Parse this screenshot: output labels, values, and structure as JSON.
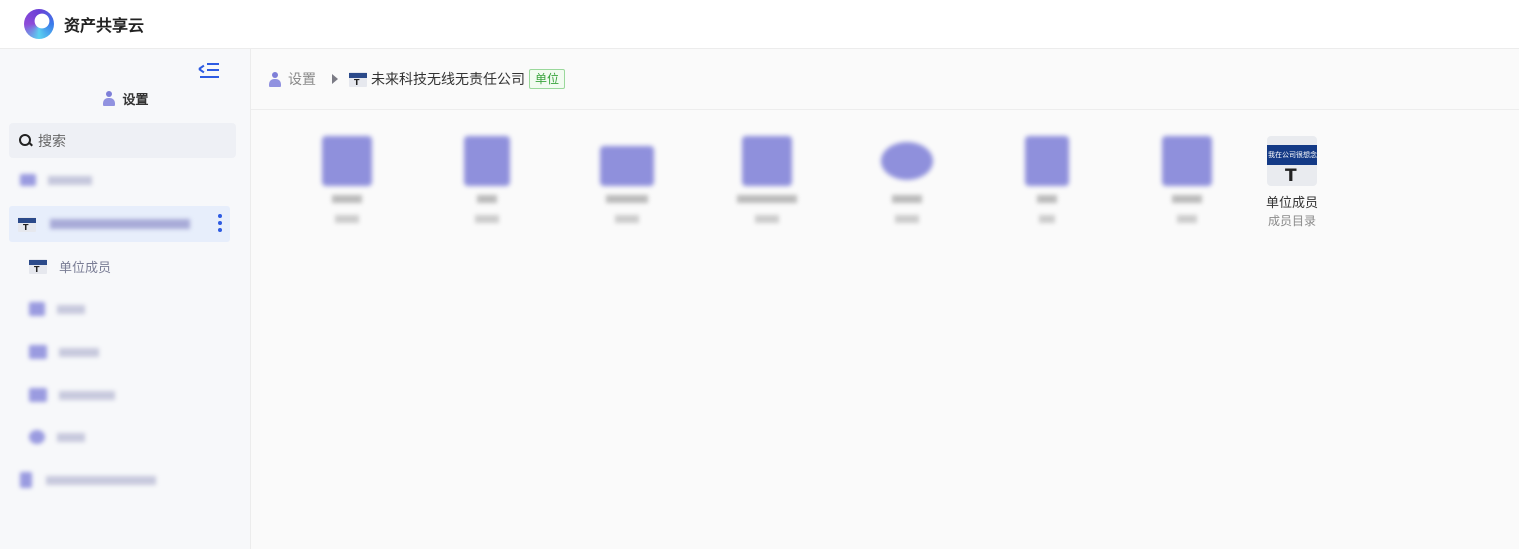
{
  "app": {
    "title": "资产共享云"
  },
  "sidebar": {
    "header": "设置",
    "search_placeholder": "搜索",
    "items": [
      {
        "label": "单位成员"
      }
    ]
  },
  "breadcrumb": {
    "settings": "设置",
    "org_name": "未来科技无线无责任公司",
    "badge": "单位"
  },
  "tiles": [
    {
      "icon": "member-directory-icon",
      "name": "单位成员",
      "desc": "成员目录",
      "sign_text": "我在公司很想念"
    }
  ],
  "colors": {
    "accent": "#2d5be3",
    "icon_purple": "#8f90dc",
    "badge_green": "#3aa43d"
  }
}
